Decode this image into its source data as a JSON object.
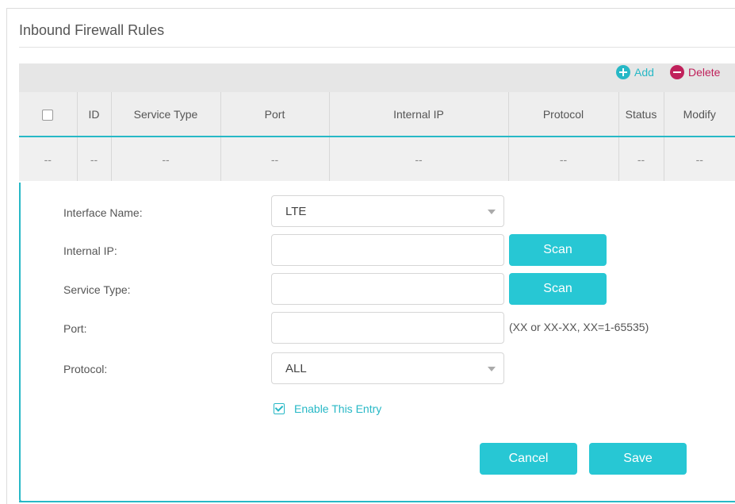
{
  "section": {
    "title": "Inbound Firewall Rules"
  },
  "toolbar": {
    "add_label": "Add",
    "delete_label": "Delete"
  },
  "table": {
    "columns": [
      "ID",
      "Service Type",
      "Port",
      "Internal IP",
      "Protocol",
      "Status",
      "Modify"
    ],
    "empty_row": [
      "--",
      "--",
      "--",
      "--",
      "--",
      "--",
      "--",
      "--"
    ]
  },
  "form": {
    "interface_name": {
      "label": "Interface Name:",
      "value": "LTE"
    },
    "internal_ip": {
      "label": "Internal IP:",
      "value": ""
    },
    "service_type": {
      "label": "Service Type:",
      "value": ""
    },
    "port": {
      "label": "Port:",
      "value": "",
      "hint": "(XX or XX-XX, XX=1-65535)"
    },
    "protocol": {
      "label": "Protocol:",
      "value": "ALL"
    },
    "scan_label": "Scan",
    "enable_label": "Enable This Entry",
    "enable_checked": true,
    "cancel_label": "Cancel",
    "save_label": "Save"
  },
  "colors": {
    "accent": "#27b8c6",
    "button": "#27c7d4",
    "delete": "#c0215b"
  }
}
